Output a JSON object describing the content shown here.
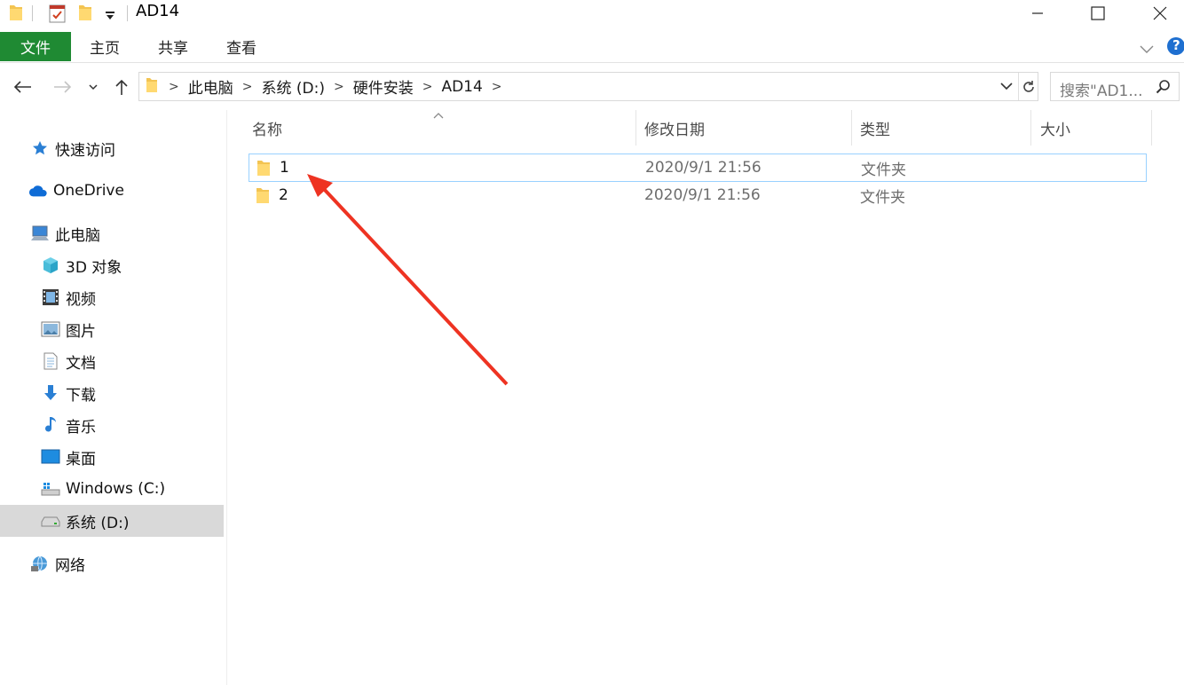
{
  "window": {
    "title": "AD14",
    "controls": [
      "minimize-icon",
      "maximize-icon",
      "close-icon"
    ]
  },
  "ribbon": {
    "tabs": [
      "文件",
      "主页",
      "共享",
      "查看"
    ],
    "help_label": "?"
  },
  "address": {
    "crumbs": [
      "此电脑",
      "系统 (D:)",
      "硬件安装",
      "AD14"
    ],
    "search_placeholder": "搜索\"AD1...",
    "colors": {
      "accent": "#1f8a33",
      "selection_border": "#99d1ff",
      "arrow": "#ee3322"
    }
  },
  "nav": {
    "items": [
      {
        "label": "快速访问",
        "icon": "star-icon"
      },
      {
        "label": "OneDrive",
        "icon": "cloud-icon"
      },
      {
        "label": "此电脑",
        "icon": "computer-icon"
      },
      {
        "label": "3D 对象",
        "icon": "cube-icon"
      },
      {
        "label": "视频",
        "icon": "video-icon"
      },
      {
        "label": "图片",
        "icon": "picture-icon"
      },
      {
        "label": "文档",
        "icon": "document-icon"
      },
      {
        "label": "下载",
        "icon": "download-icon"
      },
      {
        "label": "音乐",
        "icon": "music-icon"
      },
      {
        "label": "桌面",
        "icon": "desktop-icon"
      },
      {
        "label": "Windows (C:)",
        "icon": "windows-drive-icon"
      },
      {
        "label": "系统 (D:)",
        "icon": "drive-icon",
        "selected": true
      },
      {
        "label": "网络",
        "icon": "network-icon"
      }
    ]
  },
  "files": {
    "columns": [
      "名称",
      "修改日期",
      "类型",
      "大小"
    ],
    "rows": [
      {
        "name": "1",
        "date": "2020/9/1 21:56",
        "type": "文件夹",
        "size": ""
      },
      {
        "name": "2",
        "date": "2020/9/1 21:56",
        "type": "文件夹",
        "size": ""
      }
    ]
  }
}
